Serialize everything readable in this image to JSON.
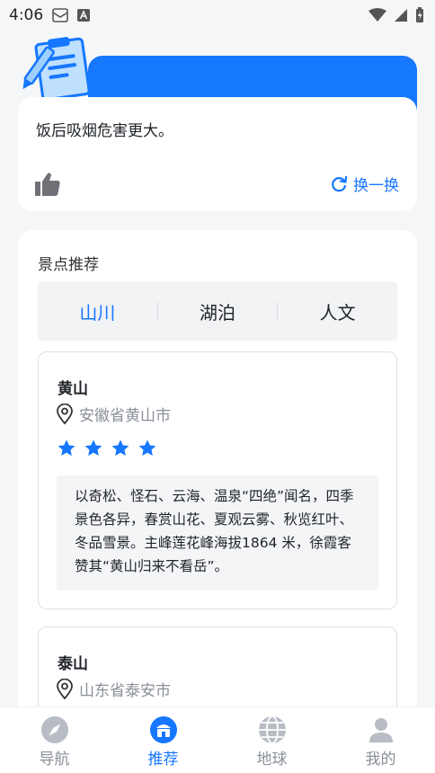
{
  "status_bar": {
    "time": "4:06"
  },
  "tip": {
    "text": "饭后吸烟危害更大。",
    "refresh_label": "换一换"
  },
  "spots": {
    "title": "景点推荐",
    "tabs": [
      {
        "label": "山川",
        "active": true
      },
      {
        "label": "湖泊",
        "active": false
      },
      {
        "label": "人文",
        "active": false
      }
    ],
    "items": [
      {
        "name": "黄山",
        "location": "安徽省黄山市",
        "rating": 4,
        "description": "以奇松、怪石、云海、温泉“四绝”闻名，四季景色各异，春赏山花、夏观云雾、秋览红叶、冬品雪景。主峰莲花峰海拔1864 米，徐霞客赞其“黄山归来不看岳”。"
      },
      {
        "name": "泰山",
        "location": "山东省泰安市"
      }
    ]
  },
  "bottom_nav": [
    {
      "label": "导航",
      "icon": "compass-icon",
      "active": false
    },
    {
      "label": "推荐",
      "icon": "recommend-icon",
      "active": true
    },
    {
      "label": "地球",
      "icon": "globe-icon",
      "active": false
    },
    {
      "label": "我的",
      "icon": "user-icon",
      "active": false
    }
  ],
  "colors": {
    "accent": "#1677ff",
    "background": "#f5f6f8",
    "muted": "#8a8f99"
  }
}
